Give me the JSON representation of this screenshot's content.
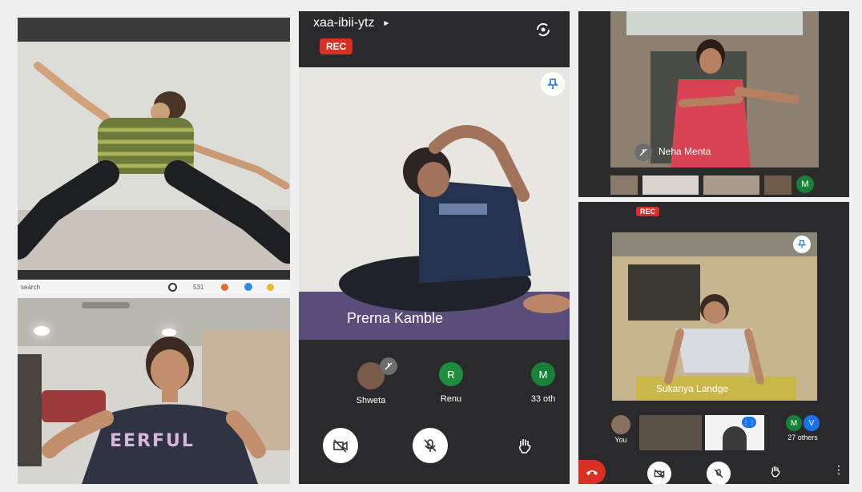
{
  "main": {
    "meeting_code": "xaa-ibii-ytz",
    "rec_label": "REC",
    "speaker_name": "Prerna Kamble",
    "participants": [
      {
        "name": "Shweta"
      },
      {
        "name": "Renu",
        "initial": "R"
      },
      {
        "name": "33 oth",
        "initial": "M"
      }
    ]
  },
  "top_right": {
    "speaker_name": "Neha Menta",
    "thumb_initial": "M"
  },
  "bottom_right": {
    "rec_label": "REC",
    "speaker_name": "Sukanya Landge",
    "thumbs": [
      {
        "name": "You"
      },
      {
        "initial_1": "M",
        "initial_2": "V",
        "name": "27 others"
      }
    ]
  },
  "taskbar": {
    "search_text": "search",
    "time_text": "531"
  },
  "colors": {
    "rec_red": "#d93025",
    "renu_green": "#1e8e3e",
    "m_green": "#188038",
    "v_blue": "#1a73e8",
    "hangup_red": "#d93025"
  }
}
